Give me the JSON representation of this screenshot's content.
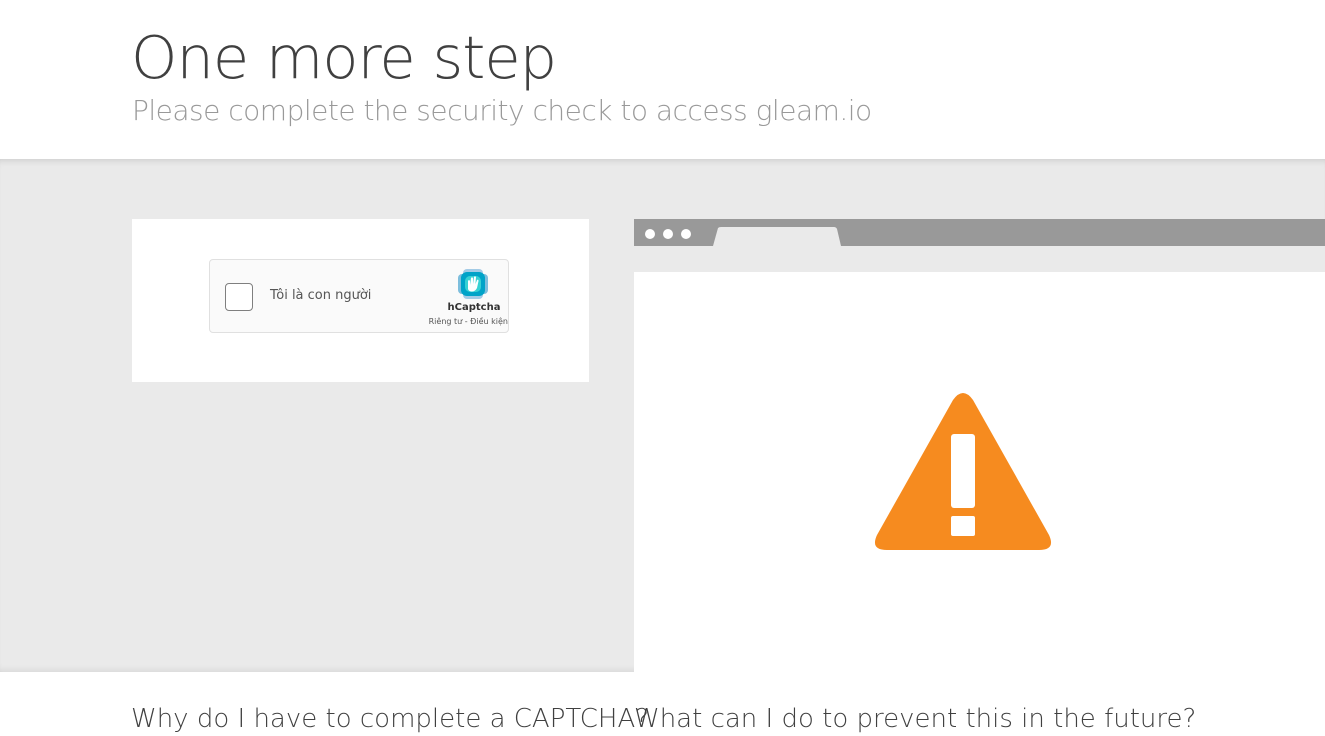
{
  "header": {
    "title": "One more step",
    "subtitle": "Please complete the security check to access gleam.io"
  },
  "captcha": {
    "checkbox_label": "Tôi là con người",
    "brand": "hCaptcha",
    "links": "Riêng tư - Điều kiện"
  },
  "browser_illustration": {
    "icon": "warning-icon",
    "icon_color": "#f68b1f"
  },
  "faq": {
    "left_heading": "Why do I have to complete a CAPTCHA?",
    "right_heading": "What can I do to prevent this in the future?"
  },
  "colors": {
    "band_background": "#eaeaea",
    "browser_bar": "#999999",
    "warning": "#f68b1f"
  }
}
